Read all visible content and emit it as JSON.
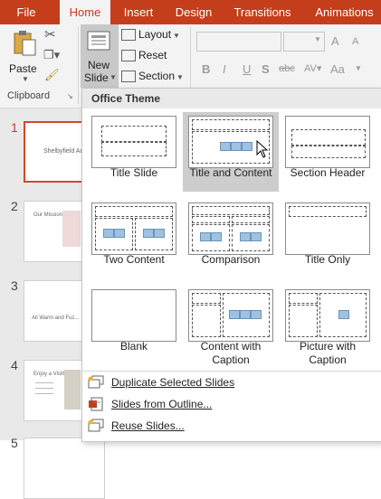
{
  "tabs": [
    "File",
    "Home",
    "Insert",
    "Design",
    "Transitions",
    "Animations"
  ],
  "ribbon": {
    "paste_label": "Paste",
    "new_slide_label_line1": "New",
    "new_slide_label_line2": "Slide",
    "layout_label": "Layout",
    "reset_label": "Reset",
    "section_label": "Section",
    "clipboard_group": "Clipboard",
    "font_bold": "B",
    "font_italic": "I",
    "font_underline": "U",
    "font_shadow": "S",
    "font_strike": "abc",
    "font_case": "Aa",
    "font_grow": "A",
    "font_shrink": "A"
  },
  "slides": [
    {
      "number": "1",
      "text": "Shelbyfield Ani..."
    },
    {
      "number": "2",
      "text": "Our Mission"
    },
    {
      "number": "3",
      "text": "All Warm and Fuz..."
    },
    {
      "number": "4",
      "text": "Enjoy a Visit!"
    },
    {
      "number": "5",
      "text": ""
    }
  ],
  "gallery": {
    "header": "Office Theme",
    "layouts": [
      {
        "name": "Title Slide"
      },
      {
        "name": "Title and Content"
      },
      {
        "name": "Section Header"
      },
      {
        "name": "Two Content"
      },
      {
        "name": "Comparison"
      },
      {
        "name": "Title Only"
      },
      {
        "name": "Blank"
      },
      {
        "name": "Content with Caption"
      },
      {
        "name": "Picture with Caption"
      }
    ],
    "menu": [
      {
        "label": "Duplicate Selected Slides"
      },
      {
        "label": "Slides from Outline..."
      },
      {
        "label": "Reuse Slides..."
      }
    ]
  },
  "colors": {
    "accent": "#c43e1c",
    "selected_border": "#d24726",
    "hover": "#cdcdcd"
  }
}
